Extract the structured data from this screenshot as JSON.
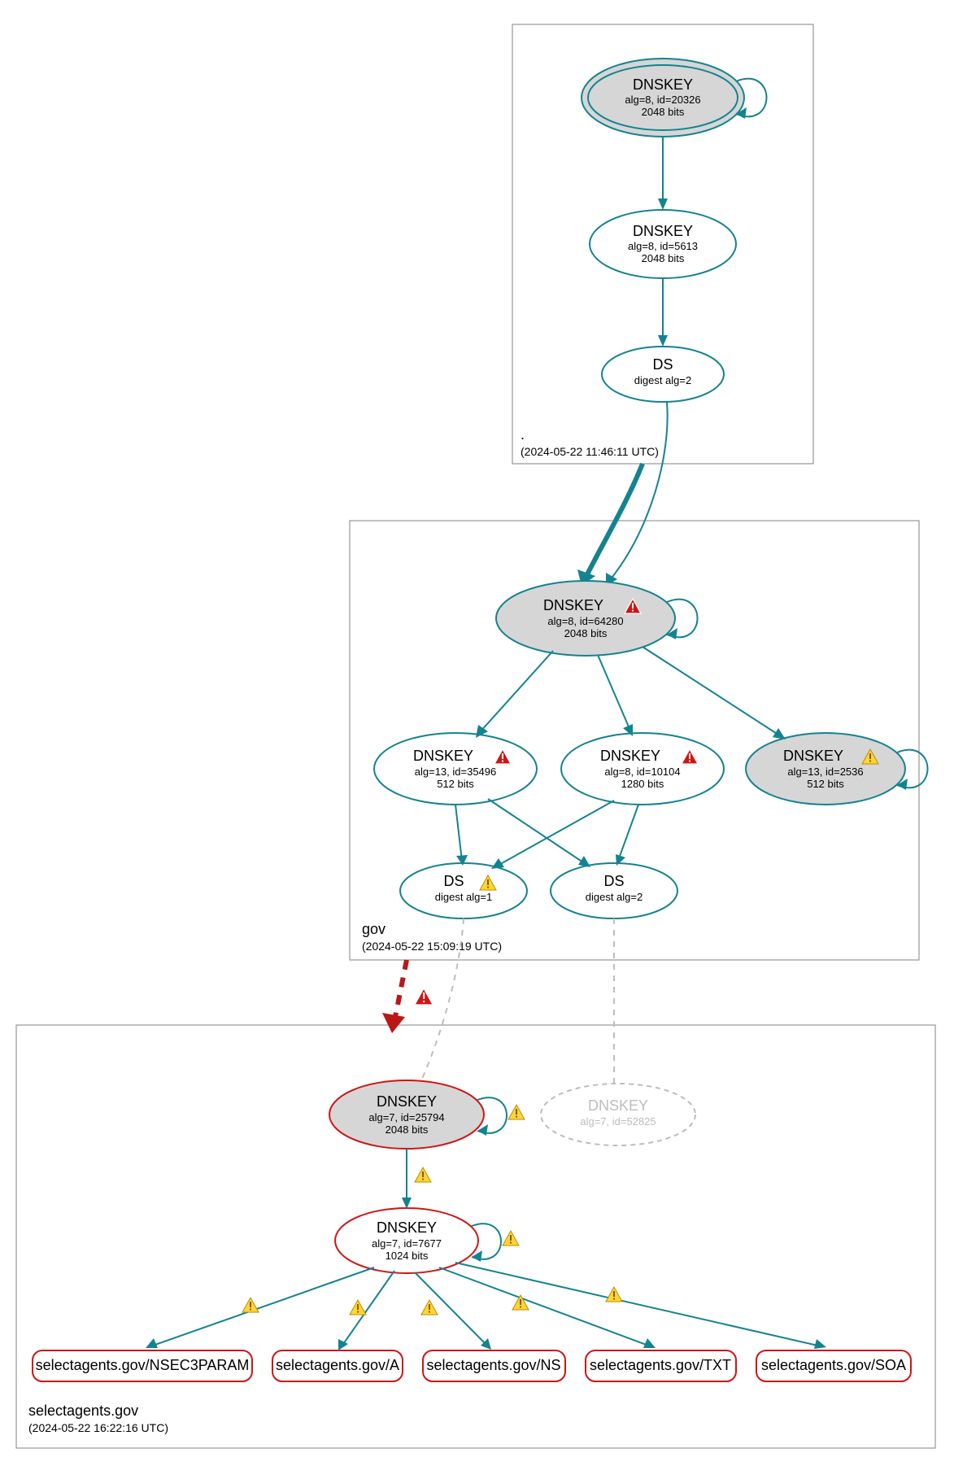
{
  "zones": {
    "root": {
      "label": ".",
      "time": "(2024-05-22 11:46:11 UTC)"
    },
    "gov": {
      "label": "gov",
      "time": "(2024-05-22 15:09:19 UTC)"
    },
    "leaf": {
      "label": "selectagents.gov",
      "time": "(2024-05-22 16:22:16 UTC)"
    }
  },
  "nodes": {
    "root_ksk": {
      "title": "DNSKEY",
      "line2": "alg=8, id=20326",
      "line3": "2048 bits"
    },
    "root_zsk": {
      "title": "DNSKEY",
      "line2": "alg=8, id=5613",
      "line3": "2048 bits"
    },
    "root_ds": {
      "title": "DS",
      "line2": "digest alg=2"
    },
    "gov_ksk": {
      "title": "DNSKEY",
      "line2": "alg=8, id=64280",
      "line3": "2048 bits"
    },
    "gov_zsk1": {
      "title": "DNSKEY",
      "line2": "alg=13, id=35496",
      "line3": "512 bits"
    },
    "gov_zsk2": {
      "title": "DNSKEY",
      "line2": "alg=8, id=10104",
      "line3": "1280 bits"
    },
    "gov_zsk3": {
      "title": "DNSKEY",
      "line2": "alg=13, id=2536",
      "line3": "512 bits"
    },
    "gov_ds1": {
      "title": "DS",
      "line2": "digest alg=1"
    },
    "gov_ds2": {
      "title": "DS",
      "line2": "digest alg=2"
    },
    "sa_ksk": {
      "title": "DNSKEY",
      "line2": "alg=7, id=25794",
      "line3": "2048 bits"
    },
    "sa_missing": {
      "title": "DNSKEY",
      "line2": "alg=7, id=52825"
    },
    "sa_zsk": {
      "title": "DNSKEY",
      "line2": "alg=7, id=7677",
      "line3": "1024 bits"
    },
    "rr_nsec3p": {
      "label": "selectagents.gov/NSEC3PARAM"
    },
    "rr_a": {
      "label": "selectagents.gov/A"
    },
    "rr_ns": {
      "label": "selectagents.gov/NS"
    },
    "rr_txt": {
      "label": "selectagents.gov/TXT"
    },
    "rr_soa": {
      "label": "selectagents.gov/SOA"
    }
  },
  "colors": {
    "teal": "#148390",
    "red": "#d11414",
    "grey_fill": "#d6d6d6",
    "box_stroke": "#808080"
  }
}
